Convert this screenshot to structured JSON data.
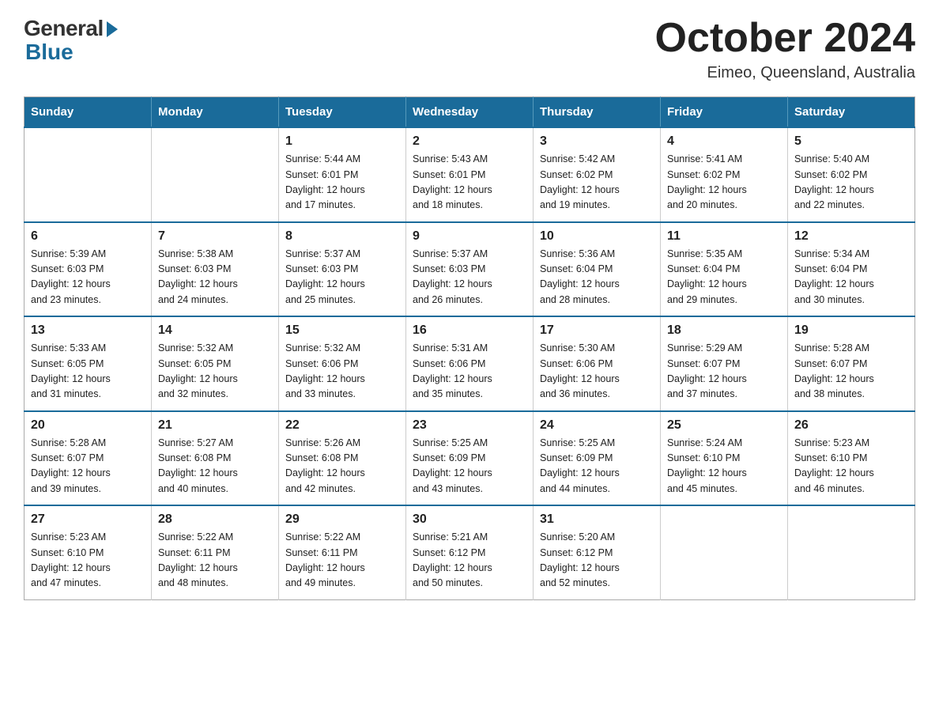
{
  "logo": {
    "general": "General",
    "blue": "Blue"
  },
  "title": "October 2024",
  "location": "Eimeo, Queensland, Australia",
  "days_of_week": [
    "Sunday",
    "Monday",
    "Tuesday",
    "Wednesday",
    "Thursday",
    "Friday",
    "Saturday"
  ],
  "weeks": [
    [
      {
        "day": "",
        "info": ""
      },
      {
        "day": "",
        "info": ""
      },
      {
        "day": "1",
        "info": "Sunrise: 5:44 AM\nSunset: 6:01 PM\nDaylight: 12 hours\nand 17 minutes."
      },
      {
        "day": "2",
        "info": "Sunrise: 5:43 AM\nSunset: 6:01 PM\nDaylight: 12 hours\nand 18 minutes."
      },
      {
        "day": "3",
        "info": "Sunrise: 5:42 AM\nSunset: 6:02 PM\nDaylight: 12 hours\nand 19 minutes."
      },
      {
        "day": "4",
        "info": "Sunrise: 5:41 AM\nSunset: 6:02 PM\nDaylight: 12 hours\nand 20 minutes."
      },
      {
        "day": "5",
        "info": "Sunrise: 5:40 AM\nSunset: 6:02 PM\nDaylight: 12 hours\nand 22 minutes."
      }
    ],
    [
      {
        "day": "6",
        "info": "Sunrise: 5:39 AM\nSunset: 6:03 PM\nDaylight: 12 hours\nand 23 minutes."
      },
      {
        "day": "7",
        "info": "Sunrise: 5:38 AM\nSunset: 6:03 PM\nDaylight: 12 hours\nand 24 minutes."
      },
      {
        "day": "8",
        "info": "Sunrise: 5:37 AM\nSunset: 6:03 PM\nDaylight: 12 hours\nand 25 minutes."
      },
      {
        "day": "9",
        "info": "Sunrise: 5:37 AM\nSunset: 6:03 PM\nDaylight: 12 hours\nand 26 minutes."
      },
      {
        "day": "10",
        "info": "Sunrise: 5:36 AM\nSunset: 6:04 PM\nDaylight: 12 hours\nand 28 minutes."
      },
      {
        "day": "11",
        "info": "Sunrise: 5:35 AM\nSunset: 6:04 PM\nDaylight: 12 hours\nand 29 minutes."
      },
      {
        "day": "12",
        "info": "Sunrise: 5:34 AM\nSunset: 6:04 PM\nDaylight: 12 hours\nand 30 minutes."
      }
    ],
    [
      {
        "day": "13",
        "info": "Sunrise: 5:33 AM\nSunset: 6:05 PM\nDaylight: 12 hours\nand 31 minutes."
      },
      {
        "day": "14",
        "info": "Sunrise: 5:32 AM\nSunset: 6:05 PM\nDaylight: 12 hours\nand 32 minutes."
      },
      {
        "day": "15",
        "info": "Sunrise: 5:32 AM\nSunset: 6:06 PM\nDaylight: 12 hours\nand 33 minutes."
      },
      {
        "day": "16",
        "info": "Sunrise: 5:31 AM\nSunset: 6:06 PM\nDaylight: 12 hours\nand 35 minutes."
      },
      {
        "day": "17",
        "info": "Sunrise: 5:30 AM\nSunset: 6:06 PM\nDaylight: 12 hours\nand 36 minutes."
      },
      {
        "day": "18",
        "info": "Sunrise: 5:29 AM\nSunset: 6:07 PM\nDaylight: 12 hours\nand 37 minutes."
      },
      {
        "day": "19",
        "info": "Sunrise: 5:28 AM\nSunset: 6:07 PM\nDaylight: 12 hours\nand 38 minutes."
      }
    ],
    [
      {
        "day": "20",
        "info": "Sunrise: 5:28 AM\nSunset: 6:07 PM\nDaylight: 12 hours\nand 39 minutes."
      },
      {
        "day": "21",
        "info": "Sunrise: 5:27 AM\nSunset: 6:08 PM\nDaylight: 12 hours\nand 40 minutes."
      },
      {
        "day": "22",
        "info": "Sunrise: 5:26 AM\nSunset: 6:08 PM\nDaylight: 12 hours\nand 42 minutes."
      },
      {
        "day": "23",
        "info": "Sunrise: 5:25 AM\nSunset: 6:09 PM\nDaylight: 12 hours\nand 43 minutes."
      },
      {
        "day": "24",
        "info": "Sunrise: 5:25 AM\nSunset: 6:09 PM\nDaylight: 12 hours\nand 44 minutes."
      },
      {
        "day": "25",
        "info": "Sunrise: 5:24 AM\nSunset: 6:10 PM\nDaylight: 12 hours\nand 45 minutes."
      },
      {
        "day": "26",
        "info": "Sunrise: 5:23 AM\nSunset: 6:10 PM\nDaylight: 12 hours\nand 46 minutes."
      }
    ],
    [
      {
        "day": "27",
        "info": "Sunrise: 5:23 AM\nSunset: 6:10 PM\nDaylight: 12 hours\nand 47 minutes."
      },
      {
        "day": "28",
        "info": "Sunrise: 5:22 AM\nSunset: 6:11 PM\nDaylight: 12 hours\nand 48 minutes."
      },
      {
        "day": "29",
        "info": "Sunrise: 5:22 AM\nSunset: 6:11 PM\nDaylight: 12 hours\nand 49 minutes."
      },
      {
        "day": "30",
        "info": "Sunrise: 5:21 AM\nSunset: 6:12 PM\nDaylight: 12 hours\nand 50 minutes."
      },
      {
        "day": "31",
        "info": "Sunrise: 5:20 AM\nSunset: 6:12 PM\nDaylight: 12 hours\nand 52 minutes."
      },
      {
        "day": "",
        "info": ""
      },
      {
        "day": "",
        "info": ""
      }
    ]
  ]
}
